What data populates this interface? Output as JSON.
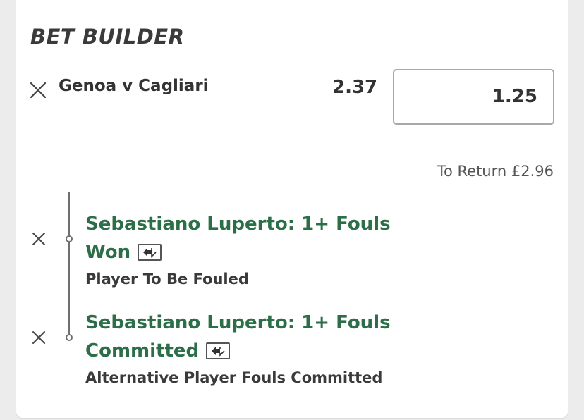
{
  "bet_builder": {
    "title": "BET BUILDER",
    "match": {
      "name": "Genoa v Cagliari",
      "odds": "2.37",
      "stake": "1.25",
      "return_label": "To Return",
      "return_value": "£2.96"
    },
    "selections": [
      {
        "title_line1": "Sebastiano Luperto: 1+ Fouls",
        "title_line2": "Won",
        "market": "Player To Be Fouled"
      },
      {
        "title_line1": "Sebastiano Luperto: 1+ Fouls",
        "title_line2": "Committed",
        "market": "Alternative Player Fouls Committed"
      }
    ]
  },
  "colors": {
    "selection_green": "#2c6e48",
    "text_dark": "#333333",
    "border_grey": "#a8a8a8"
  },
  "icons": [
    "close-icon",
    "swap-icon"
  ]
}
